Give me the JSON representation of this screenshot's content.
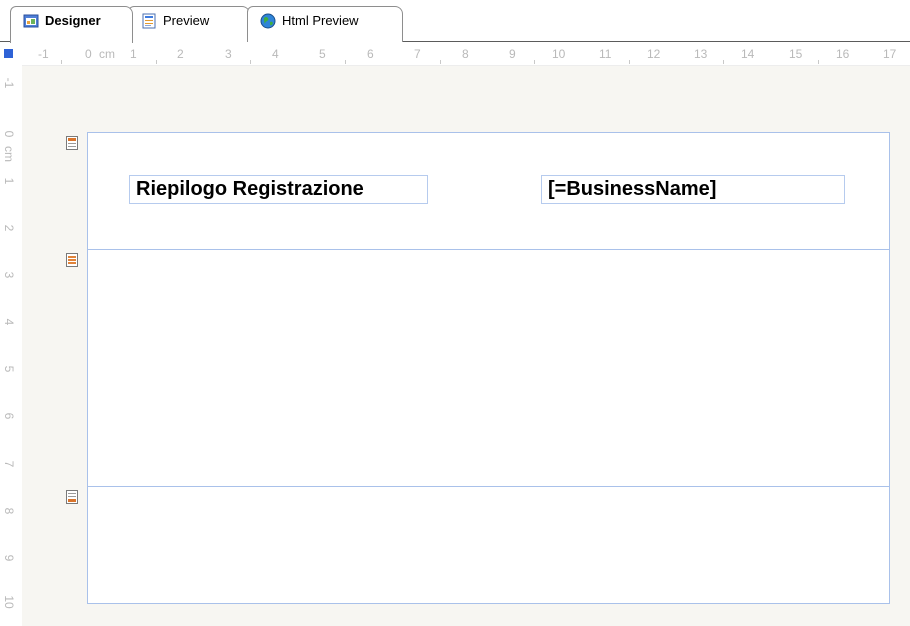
{
  "tabs": [
    {
      "label": "Designer",
      "icon": "designer-icon",
      "active": true
    },
    {
      "label": "Preview",
      "icon": "preview-icon",
      "active": false
    },
    {
      "label": "Html Preview",
      "icon": "globe-icon",
      "active": false
    }
  ],
  "ruler": {
    "unit": "cm",
    "horizontal": [
      "-1",
      "0",
      "cm",
      "1",
      "2",
      "3",
      "4",
      "5",
      "6",
      "7",
      "8",
      "9",
      "10",
      "11",
      "12",
      "13",
      "14",
      "15",
      "16",
      "17"
    ],
    "vertical": [
      "-1",
      "0",
      "cm",
      "1",
      "2",
      "3",
      "4",
      "5",
      "6",
      "7",
      "8",
      "9",
      "10"
    ]
  },
  "report": {
    "title_field": "Riepilogo Registrazione",
    "business_field": "[=BusinessName]"
  },
  "bands": [
    {
      "name": "page-header-band",
      "icon": "header-band-icon"
    },
    {
      "name": "detail-band",
      "icon": "detail-band-icon"
    },
    {
      "name": "page-footer-band",
      "icon": "footer-band-icon"
    }
  ]
}
